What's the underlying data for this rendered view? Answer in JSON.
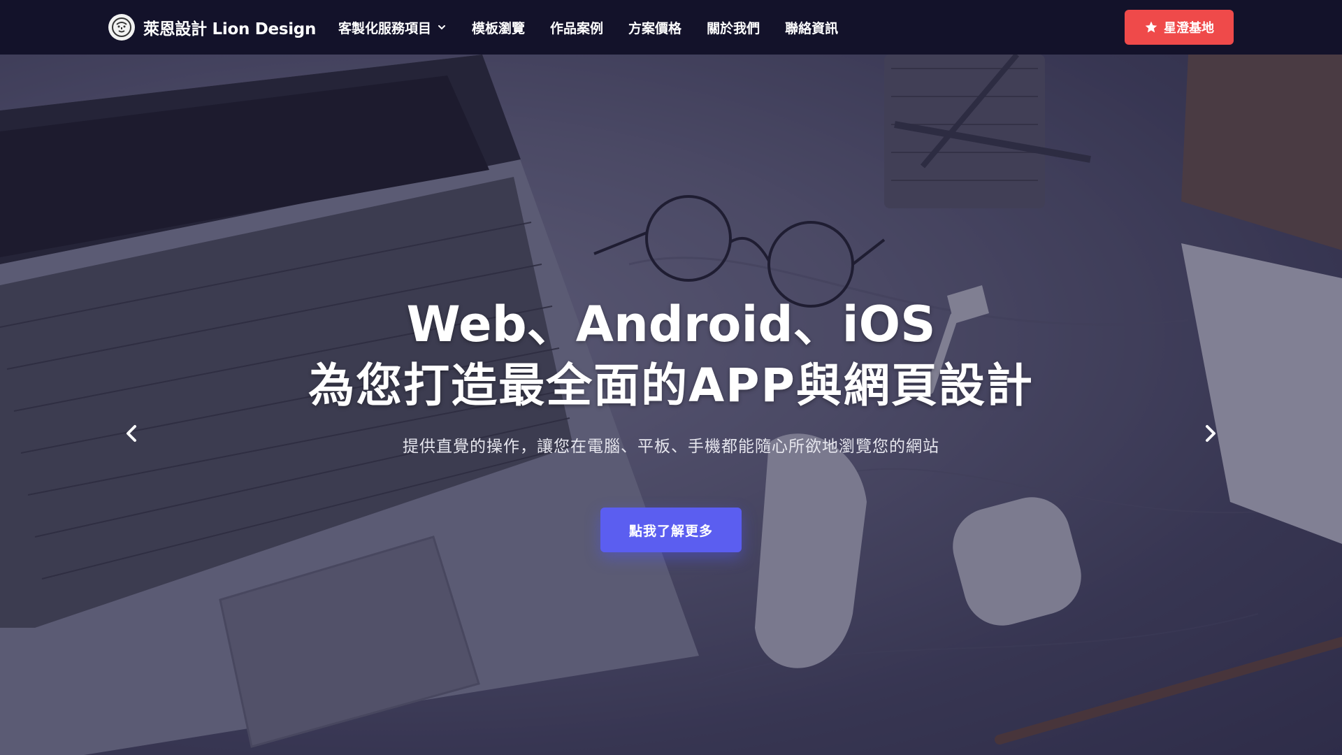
{
  "brand": {
    "name": "萊恩設計 Lion Design",
    "logo_icon": "lion-logo-icon"
  },
  "nav": {
    "items": [
      {
        "label": "客製化服務項目",
        "has_dropdown": true
      },
      {
        "label": "模板瀏覽"
      },
      {
        "label": "作品案例"
      },
      {
        "label": "方案價格"
      },
      {
        "label": "關於我們"
      },
      {
        "label": "聯絡資訊"
      }
    ],
    "cta": {
      "label": "星澄基地",
      "icon": "star-icon",
      "color": "#ef4a4a"
    }
  },
  "hero": {
    "title_line1": "Web、Android、iOS",
    "title_line2": "為您打造最全面的APP與網頁設計",
    "subtitle": "提供直覺的操作，讓您在電腦、平板、手機都能隨心所欲地瀏覽您的網站",
    "button_label": "點我了解更多",
    "button_color": "#5b5ef0",
    "prev_icon": "chevron-left-icon",
    "next_icon": "chevron-right-icon"
  },
  "colors": {
    "navbar_bg": "#13122a",
    "overlay": "rgba(32,28,62,0.45)"
  }
}
